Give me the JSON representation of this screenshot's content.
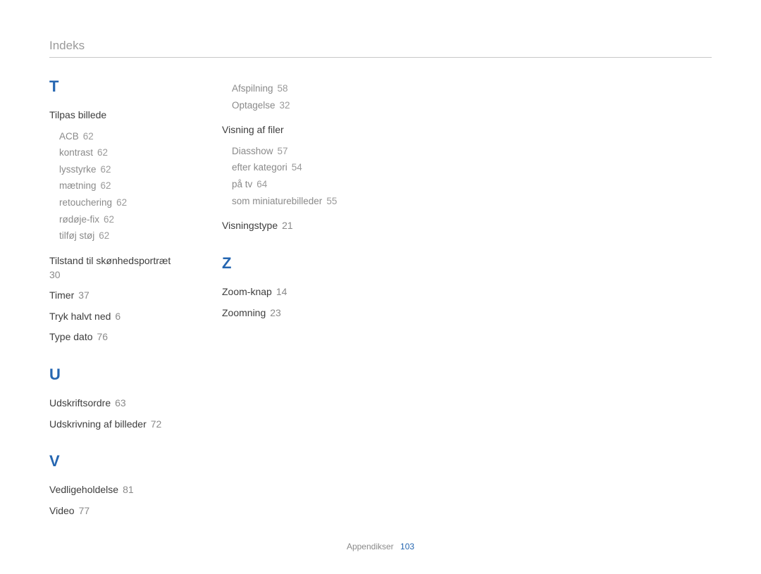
{
  "header": {
    "title": "Indeks"
  },
  "footer": {
    "section": "Appendikser",
    "page": "103"
  },
  "sections": {
    "T": {
      "letter": "T",
      "tilpas": {
        "title": "Tilpas billede",
        "items": [
          {
            "label": "ACB",
            "page": "62"
          },
          {
            "label": "kontrast",
            "page": "62"
          },
          {
            "label": "lysstyrke",
            "page": "62"
          },
          {
            "label": "mætning",
            "page": "62"
          },
          {
            "label": "retouchering",
            "page": "62"
          },
          {
            "label": "rødøje-fix",
            "page": "62"
          },
          {
            "label": "tilføj støj",
            "page": "62"
          }
        ]
      },
      "tilstand": {
        "label": "Tilstand til skønhedsportræt",
        "page": "30"
      },
      "timer": {
        "label": "Timer",
        "page": "37"
      },
      "tryk": {
        "label": "Tryk halvt ned",
        "page": "6"
      },
      "typedato": {
        "label": "Type dato",
        "page": "76"
      }
    },
    "U": {
      "letter": "U",
      "udskriftsordre": {
        "label": "Udskriftsordre",
        "page": "63"
      },
      "udskrivning": {
        "label": "Udskrivning af billeder",
        "page": "72"
      }
    },
    "V": {
      "letter": "V",
      "vedligeholdelse": {
        "label": "Vedligeholdelse",
        "page": "81"
      },
      "video": {
        "label": "Video",
        "page": "77",
        "items": [
          {
            "label": "Afspilning",
            "page": "58"
          },
          {
            "label": "Optagelse",
            "page": "32"
          }
        ]
      },
      "visningfiler": {
        "title": "Visning af filer",
        "items": [
          {
            "label": "Diasshow",
            "page": "57"
          },
          {
            "label": "efter kategori",
            "page": "54"
          },
          {
            "label": "på tv",
            "page": "64"
          },
          {
            "label": "som miniaturebilleder",
            "page": "55"
          }
        ]
      },
      "visningstype": {
        "label": "Visningstype",
        "page": "21"
      }
    },
    "Z": {
      "letter": "Z",
      "zoomknap": {
        "label": "Zoom-knap",
        "page": "14"
      },
      "zoomning": {
        "label": "Zoomning",
        "page": "23"
      }
    }
  }
}
